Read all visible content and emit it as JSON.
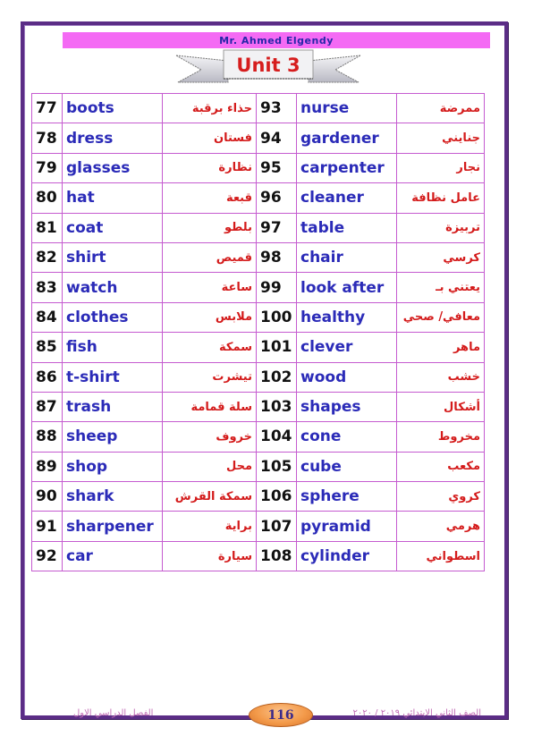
{
  "header": {
    "author": "Mr. Ahmed Elgendy",
    "unit_title": "Unit 3"
  },
  "colors": {
    "frame": "#5b2d86",
    "header_bar": "#f46af4",
    "english": "#2b2bb8",
    "arabic": "#d41b1b",
    "grid": "#c55bd0",
    "page_badge": "#f39a4a"
  },
  "rows": [
    {
      "n1": "77",
      "en1": "boots",
      "ar1": "حذاء برقبة",
      "n2": "93",
      "en2": "nurse",
      "ar2": "ممرضة"
    },
    {
      "n1": "78",
      "en1": "dress",
      "ar1": "فستان",
      "n2": "94",
      "en2": "gardener",
      "ar2": "جنايني"
    },
    {
      "n1": "79",
      "en1": "glasses",
      "ar1": "نظارة",
      "n2": "95",
      "en2": "carpenter",
      "ar2": "نجار"
    },
    {
      "n1": "80",
      "en1": "hat",
      "ar1": "قبعة",
      "n2": "96",
      "en2": "cleaner",
      "ar2": "عامل نظافة"
    },
    {
      "n1": "81",
      "en1": "coat",
      "ar1": "بلطو",
      "n2": "97",
      "en2": "table",
      "ar2": "تربيزة"
    },
    {
      "n1": "82",
      "en1": "shirt",
      "ar1": "قميص",
      "n2": "98",
      "en2": "chair",
      "ar2": "كرسي"
    },
    {
      "n1": "83",
      "en1": "watch",
      "ar1": "ساعة",
      "n2": "99",
      "en2": "look after",
      "ar2": "يعتني بـ"
    },
    {
      "n1": "84",
      "en1": "clothes",
      "ar1": "ملابس",
      "n2": "100",
      "en2": "healthy",
      "ar2": "معافي/ صحي"
    },
    {
      "n1": "85",
      "en1": "fish",
      "ar1": "سمكة",
      "n2": "101",
      "en2": "clever",
      "ar2": "ماهر"
    },
    {
      "n1": "86",
      "en1": "t-shirt",
      "ar1": "تيشرت",
      "n2": "102",
      "en2": "wood",
      "ar2": "خشب"
    },
    {
      "n1": "87",
      "en1": "trash",
      "ar1": "سلة قمامة",
      "n2": "103",
      "en2": "shapes",
      "ar2": "أشكال"
    },
    {
      "n1": "88",
      "en1": "sheep",
      "ar1": "خروف",
      "n2": "104",
      "en2": "cone",
      "ar2": "مخروط"
    },
    {
      "n1": "89",
      "en1": "shop",
      "ar1": "محل",
      "n2": "105",
      "en2": "cube",
      "ar2": "مكعب"
    },
    {
      "n1": "90",
      "en1": "shark",
      "ar1": "سمكة القرش",
      "n2": "106",
      "en2": "sphere",
      "ar2": "كروي"
    },
    {
      "n1": "91",
      "en1": "sharpener",
      "ar1": "براية",
      "n2": "107",
      "en2": "pyramid",
      "ar2": "هرمي"
    },
    {
      "n1": "92",
      "en1": "car",
      "ar1": "سيارة",
      "n2": "108",
      "en2": "cylinder",
      "ar2": "اسطواني"
    }
  ],
  "footer": {
    "term": "الفصل الدراسي الاول",
    "page_number": "116",
    "grade_year": "الصف الثاني الابتدائي ٢٠١٩ / ٢٠٢٠"
  }
}
